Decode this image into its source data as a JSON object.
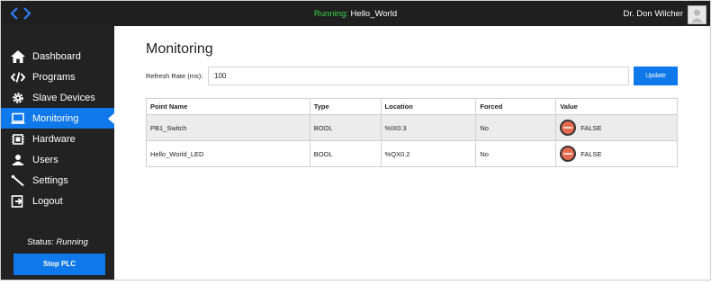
{
  "header": {
    "running_prefix": "Running:",
    "program_name": "Hello_World",
    "user_name": "Dr. Don Wilcher"
  },
  "sidebar": {
    "items": [
      {
        "label": "Dashboard",
        "icon": "home-icon",
        "active": false
      },
      {
        "label": "Programs",
        "icon": "code-icon",
        "active": false
      },
      {
        "label": "Slave Devices",
        "icon": "cog-icon",
        "active": false
      },
      {
        "label": "Monitoring",
        "icon": "monitor-icon",
        "active": true
      },
      {
        "label": "Hardware",
        "icon": "chip-icon",
        "active": false
      },
      {
        "label": "Users",
        "icon": "users-icon",
        "active": false
      },
      {
        "label": "Settings",
        "icon": "wrench-icon",
        "active": false
      },
      {
        "label": "Logout",
        "icon": "logout-icon",
        "active": false
      }
    ],
    "status_label": "Status:",
    "status_value": "Running",
    "stop_button": "Stop PLC"
  },
  "main": {
    "title": "Monitoring",
    "refresh_label": "Refresh Rate (ms):",
    "refresh_value": "100",
    "update_button": "Update",
    "table": {
      "headers": [
        "Point Name",
        "Type",
        "Location",
        "Forced",
        "Value"
      ],
      "rows": [
        {
          "name": "PB1_Switch",
          "type": "BOOL",
          "location": "%IX0.3",
          "forced": "No",
          "value": "FALSE"
        },
        {
          "name": "Hello_World_LED",
          "type": "BOOL",
          "location": "%QX0.2",
          "forced": "No",
          "value": "FALSE"
        }
      ]
    }
  },
  "colors": {
    "accent": "#0f78ea",
    "sidebar_bg": "#222222",
    "topbar_bg": "#1f1f1f",
    "running_green": "#37d34a",
    "led_off": "#e36a4f"
  }
}
